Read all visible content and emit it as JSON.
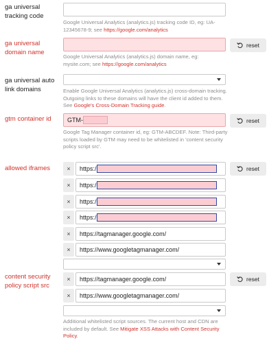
{
  "reset_label": "reset",
  "fields": {
    "ga_tracking": {
      "label": "ga universal tracking code",
      "value": "",
      "help": "Google Universal Analytics (analytics.js) tracking code ID, eg: UA-12345678-9; see ",
      "help_link": "https://google.com/analytics"
    },
    "ga_domain": {
      "label": "ga universal domain name",
      "value": "",
      "help": "Google Universal Analytics (analytics.js) domain name, eg: mysite.com; see ",
      "help_link": "https://google.com/analytics"
    },
    "ga_autolink": {
      "label": "ga universal auto link domains",
      "selected": "",
      "help": "Enable Google Universal Analytics (analytics.js) cross-domain tracking. Outgoing links to these domains will have the client id added to them. See ",
      "help_link": "Google's Cross-Domain Tracking guide",
      "help_end": "."
    },
    "gtm": {
      "label": "gtm container id",
      "value_prefix": "GTM-",
      "help": "Google Tag Manager container id, eg: GTM-ABCDEF. Note: Third-party scripts loaded by GTM may need to be whitelisted in 'content security policy script src'."
    },
    "iframes": {
      "label": "allowed iframes",
      "remove_symbol": "×",
      "items": [
        "https:/",
        "https:/",
        "https:/",
        "https:/",
        "https://tagmanager.google.com/",
        "https://www.googletagmanager.com/"
      ],
      "add_selected": ""
    },
    "csp": {
      "label": "content security policy script src",
      "remove_symbol": "×",
      "items": [
        "https://tagmanager.google.com/",
        "https://www.googletagmanager.com/"
      ],
      "add_selected": "",
      "help": "Additional whitelisted script sources. The current host and CDN are included by default. See ",
      "help_link": "Mitigate XSS Attacks with Content Security Policy",
      "help_end": "."
    }
  }
}
